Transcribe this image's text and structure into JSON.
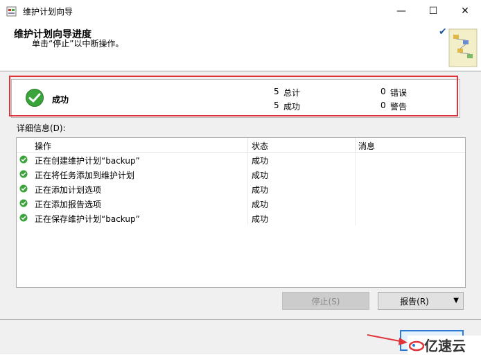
{
  "window": {
    "title": "维护计划向导",
    "minimize_glyph": "—",
    "maximize_glyph": "☐",
    "close_glyph": "✕"
  },
  "header": {
    "title": "维护计划向导进度",
    "subtitle": "单击“停止”以中断操作。"
  },
  "summary": {
    "status_label": "成功",
    "total_count": "5",
    "total_label": "总计",
    "success_count": "5",
    "success_label": "成功",
    "error_count": "0",
    "error_label": "错误",
    "warning_count": "0",
    "warning_label": "警告"
  },
  "details": {
    "label": "详细信息(D):",
    "columns": [
      "操作",
      "状态",
      "消息"
    ],
    "rows": [
      {
        "operation": "正在创建维护计划“backup”",
        "status": "成功",
        "message": ""
      },
      {
        "operation": "正在将任务添加到维护计划",
        "status": "成功",
        "message": ""
      },
      {
        "operation": "正在添加计划选项",
        "status": "成功",
        "message": ""
      },
      {
        "operation": "正在添加报告选项",
        "status": "成功",
        "message": ""
      },
      {
        "operation": "正在保存维护计划“backup”",
        "status": "成功",
        "message": ""
      }
    ]
  },
  "buttons": {
    "stop": "停止(S)",
    "report": "报告(R)",
    "report_arrow": "▼",
    "close": "关闭"
  },
  "watermark": {
    "text": "亿速云"
  },
  "colors": {
    "highlight_frame": "#e0343a",
    "success_green": "#3aa33a",
    "accent_blue": "#2b7bd8"
  }
}
